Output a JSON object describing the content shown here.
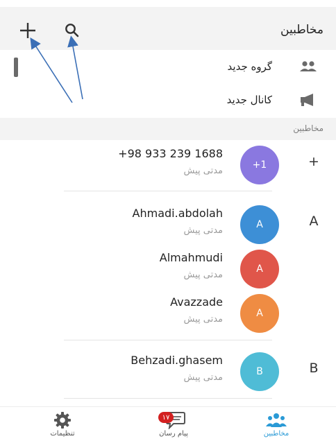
{
  "header": {
    "title": "مخاطبین",
    "add_icon": "plus-icon",
    "search_icon": "search-icon"
  },
  "menu": [
    {
      "label": "گروه جدید",
      "icon": "group-icon"
    },
    {
      "label": "کانال جدید",
      "icon": "megaphone-icon"
    }
  ],
  "section": {
    "title": "مخاطبین"
  },
  "contacts": [
    {
      "name": "+98 933 239 1688",
      "status": "مدتی پیش",
      "avatar_text": "+1",
      "avatar_color": "#8a78e0",
      "index_letter": "+"
    },
    {
      "name": "Ahmadi.abdolah",
      "status": "مدتی پیش",
      "avatar_text": "A",
      "avatar_color": "#3d8fd6",
      "index_letter": "A"
    },
    {
      "name": "Almahmudi",
      "status": "مدتی پیش",
      "avatar_text": "A",
      "avatar_color": "#e0564a",
      "index_letter": ""
    },
    {
      "name": "Avazzade",
      "status": "مدتی پیش",
      "avatar_text": "A",
      "avatar_color": "#ef8c43",
      "index_letter": ""
    },
    {
      "name": "Behzadi.ghasem",
      "status": "مدتی پیش",
      "avatar_text": "B",
      "avatar_color": "#4fbcd6",
      "index_letter": "B"
    }
  ],
  "bottom_nav": {
    "settings": {
      "label": "تنظیمات",
      "icon": "gear-icon"
    },
    "messenger": {
      "label": "پیام رسان",
      "icon": "chat-icon",
      "badge": "۱۷"
    },
    "contacts": {
      "label": "مخاطبین",
      "icon": "contacts-icon"
    }
  },
  "colors": {
    "accent": "#2a9ad6",
    "annotation_arrow": "#3b6fb6",
    "badge": "#d32020"
  }
}
